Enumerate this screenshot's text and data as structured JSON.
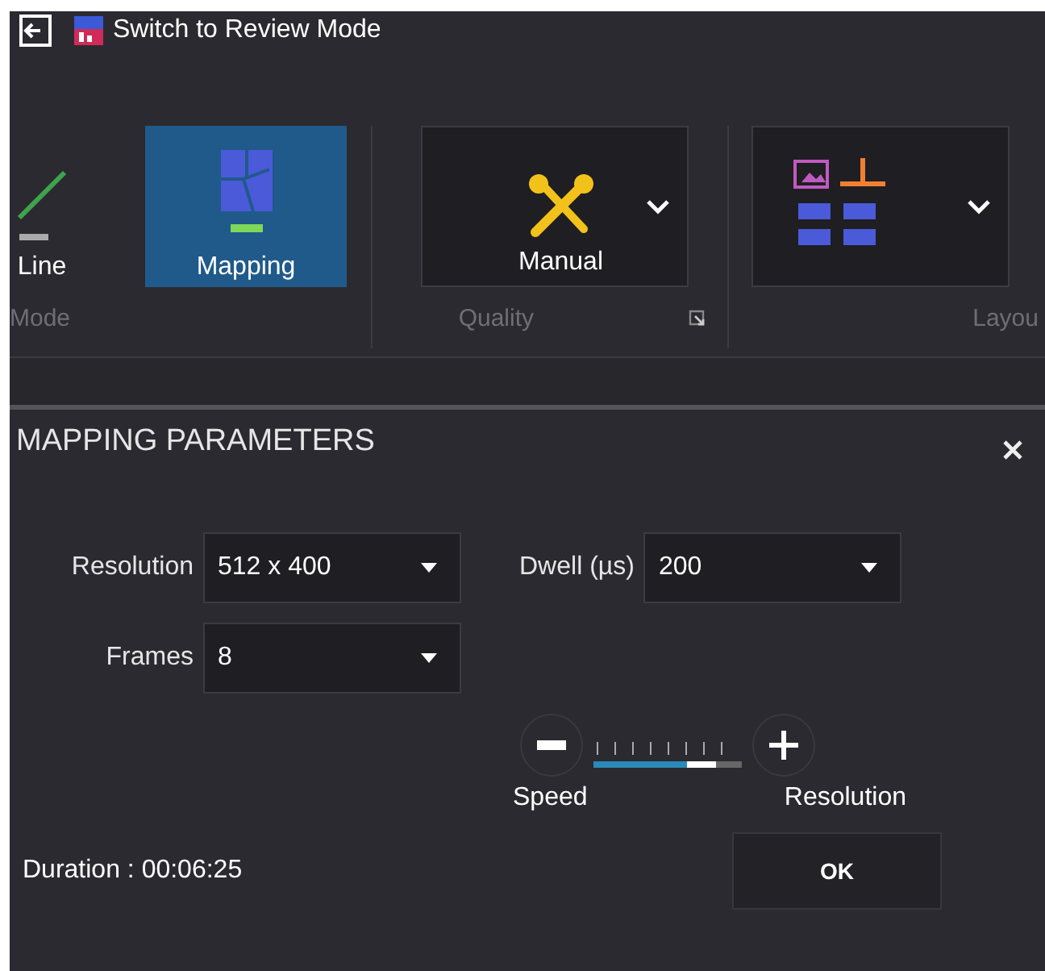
{
  "toolbar": {
    "title": "Switch to Review Mode"
  },
  "ribbon": {
    "groups": [
      {
        "label": "Mode",
        "launcher": false,
        "buttons": [
          {
            "label": "Line",
            "kind": "line",
            "selected": false
          },
          {
            "label": "Mapping",
            "kind": "mapping",
            "selected": true
          }
        ]
      },
      {
        "label": "Quality",
        "launcher": true,
        "buttons": [
          {
            "label": "Manual",
            "kind": "tools",
            "dropdown": true
          }
        ]
      },
      {
        "label": "Layou",
        "launcher": false,
        "buttons": [
          {
            "kind": "layout",
            "dropdown": true
          }
        ]
      }
    ]
  },
  "panel": {
    "title": "MAPPING PARAMETERS",
    "fields": [
      {
        "label": "Resolution",
        "value": "512 x 400"
      },
      {
        "label": "Dwell (µs)",
        "value": "200"
      },
      {
        "label": "Frames",
        "value": "8"
      }
    ],
    "slider": {
      "level": 0.7,
      "min_label": "Speed",
      "max_label": "Resolution"
    },
    "duration": "Duration : 00:06:25",
    "button": "OK"
  }
}
